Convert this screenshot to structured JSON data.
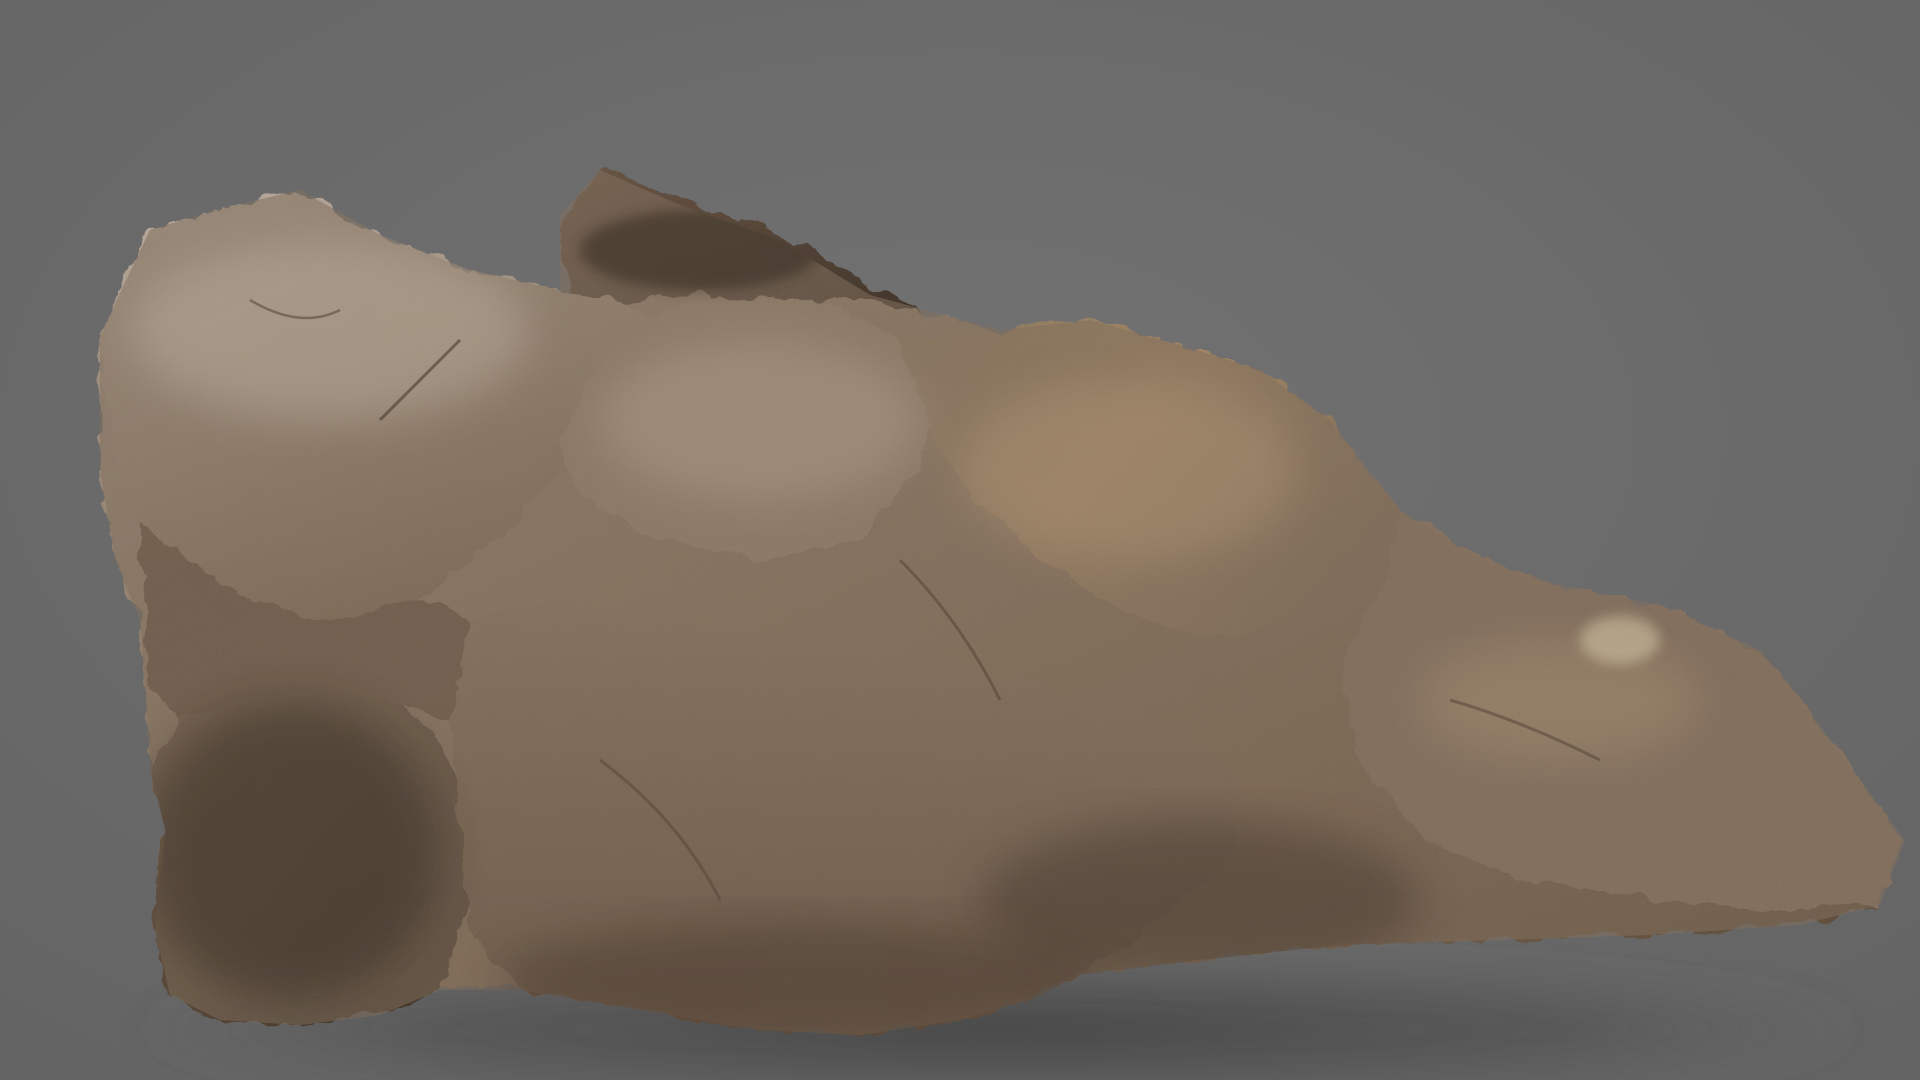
{
  "scene": {
    "subject": "rock-model-render",
    "background_color": "#6b6b6b",
    "ground_shadow_color": "#4d4d4d",
    "rock_colors": {
      "highlight": "#b3a596",
      "light": "#9c8b78",
      "mid": "#7d6a56",
      "dark": "#4e3f31",
      "deep": "#2f261e",
      "warm_accent": "#a8875f",
      "pale_accent": "#c9bb9e"
    }
  }
}
